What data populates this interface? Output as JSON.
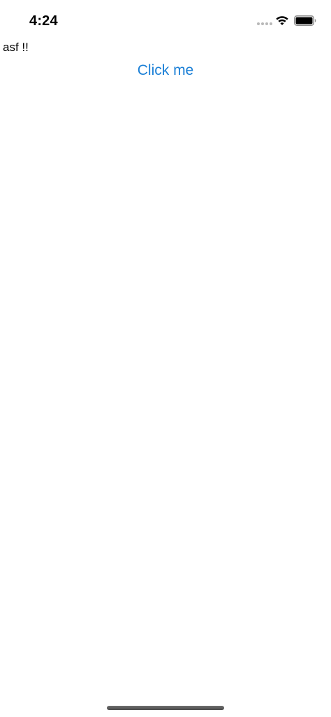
{
  "status_bar": {
    "time": "4:24",
    "icons": [
      "signal-dots-icon",
      "wifi-icon",
      "battery-icon"
    ]
  },
  "main": {
    "label": "asf !!",
    "button_label": "Click me",
    "button_color": "#1a7fd6"
  },
  "colors": {
    "background": "#ffffff",
    "text": "#000000",
    "accent": "#1a7fd6"
  }
}
